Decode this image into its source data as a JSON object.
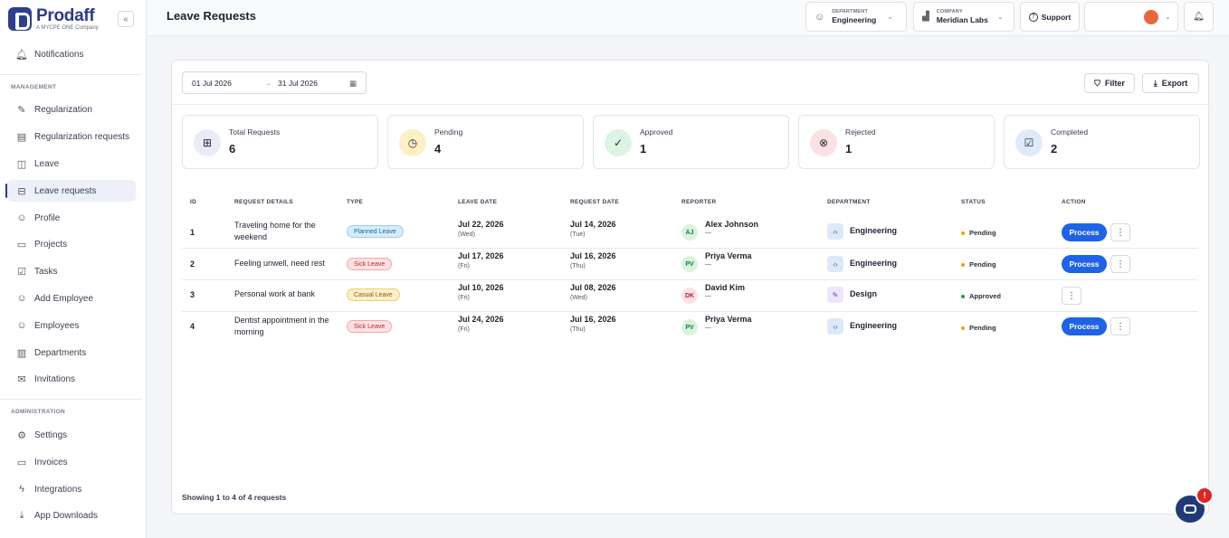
{
  "brand": {
    "name": "Prodaff",
    "tagline": "A MYCPE ONE Company",
    "collapse": "«"
  },
  "sidebar": {
    "top_items": [
      {
        "label": "Notifications",
        "icon": "bell-icon"
      }
    ],
    "management_label": "MANAGEMENT",
    "management_items": [
      {
        "label": "Regularization",
        "icon": "pen-icon"
      },
      {
        "label": "Regularization requests",
        "icon": "document-icon"
      },
      {
        "label": "Leave",
        "icon": "suitcase-icon"
      },
      {
        "label": "Leave requests",
        "icon": "inbox-icon",
        "active": true
      },
      {
        "label": "Profile",
        "icon": "user-icon"
      },
      {
        "label": "Projects",
        "icon": "folder-icon"
      },
      {
        "label": "Tasks",
        "icon": "checkbox-icon"
      },
      {
        "label": "Add Employee",
        "icon": "user-plus-icon"
      },
      {
        "label": "Employees",
        "icon": "users-icon"
      },
      {
        "label": "Departments",
        "icon": "building-icon"
      },
      {
        "label": "Invitations",
        "icon": "mail-icon"
      }
    ],
    "administration_label": "ADMINISTRATION",
    "administration_items": [
      {
        "label": "Settings",
        "icon": "gear-icon"
      },
      {
        "label": "Invoices",
        "icon": "card-icon"
      },
      {
        "label": "Integrations",
        "icon": "lightning-icon"
      },
      {
        "label": "App Downloads",
        "icon": "download-icon"
      }
    ]
  },
  "header": {
    "title": "Leave Requests",
    "department": {
      "label": "DEPARTMENT",
      "value": "Engineering"
    },
    "company": {
      "label": "COMPANY",
      "value": "Meridian Labs"
    },
    "support": "Support"
  },
  "filters": {
    "date_from": "01 Jul 2026",
    "arrow": "→",
    "date_to": "31 Jul 2026",
    "filter_label": "Filter",
    "export_label": "Export"
  },
  "stats": [
    {
      "label": "Total Requests",
      "value": "6",
      "icon": "grid-icon",
      "bg": "#e9ebf7",
      "fg": "#333"
    },
    {
      "label": "Pending",
      "value": "4",
      "icon": "clock-icon",
      "bg": "#fdf0c4",
      "fg": "#333"
    },
    {
      "label": "Approved",
      "value": "1",
      "icon": "check-circle-icon",
      "bg": "#dcf5e3",
      "fg": "#333"
    },
    {
      "label": "Rejected",
      "value": "1",
      "icon": "x-circle-icon",
      "bg": "#fbe2e2",
      "fg": "#333"
    },
    {
      "label": "Completed",
      "value": "2",
      "icon": "check-square-icon",
      "bg": "#dfeaf9",
      "fg": "#333"
    }
  ],
  "table": {
    "columns": [
      "ID",
      "REQUEST DETAILS",
      "TYPE",
      "LEAVE DATE",
      "REQUEST DATE",
      "REPORTER",
      "DEPARTMENT",
      "STATUS",
      "ACTION"
    ],
    "rows": [
      {
        "id": "1",
        "details": "Traveling home for the weekend",
        "type": "Planned Leave",
        "type_class": "planned",
        "leave_date": "Jul 22, 2026",
        "leave_day": "(Wed)",
        "request_date": "Jul 14, 2026",
        "request_day": "(Tue)",
        "initials": "AJ",
        "reporter": "Alex Johnson",
        "reporter_sub": "—",
        "department": "Engineering",
        "dept_icon": "‹›",
        "status": "Pending",
        "status_color": "#f59e0b",
        "action": "Process",
        "more": "⋮"
      },
      {
        "id": "2",
        "details": "Feeling unwell, need rest",
        "type": "Sick Leave",
        "type_class": "sick",
        "leave_date": "Jul 17, 2026",
        "leave_day": "(Fri)",
        "request_date": "Jul 16, 2026",
        "request_day": "(Thu)",
        "initials": "PV",
        "reporter": "Priya Verma",
        "reporter_sub": "—",
        "department": "Engineering",
        "dept_icon": "‹›",
        "status": "Pending",
        "status_color": "#f59e0b",
        "action": "Process",
        "more": "⋮"
      },
      {
        "id": "3",
        "details": "Personal work at bank",
        "type": "Casual Leave",
        "type_class": "casual",
        "leave_date": "Jul 10, 2026",
        "leave_day": "(Fri)",
        "request_date": "Jul 08, 2026",
        "request_day": "(Wed)",
        "initials": "DK",
        "reporter": "David Kim",
        "reporter_sub": "—",
        "department": "Design",
        "dept_icon": "✎",
        "status": "Approved",
        "status_color": "#16a34a",
        "action": "",
        "more": "⋮"
      },
      {
        "id": "4",
        "details": "Dentist appointment in the morning",
        "type": "Sick Leave",
        "type_class": "sick",
        "leave_date": "Jul 24, 2026",
        "leave_day": "(Fri)",
        "request_date": "Jul 16, 2026",
        "request_day": "(Thu)",
        "initials": "PV",
        "reporter": "Priya Verma",
        "reporter_sub": "—",
        "department": "Engineering",
        "dept_icon": "‹›",
        "status": "Pending",
        "status_color": "#f59e0b",
        "action": "Process",
        "more": "⋮"
      }
    ],
    "footer": "Showing 1 to 4 of 4 requests"
  },
  "chat": {
    "badge": "!"
  }
}
